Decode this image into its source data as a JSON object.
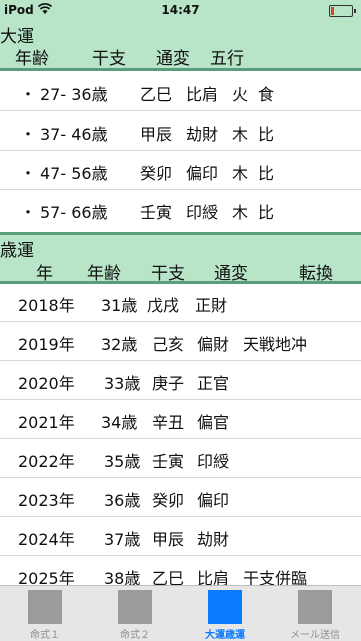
{
  "status": {
    "carrier": "iPod",
    "time": "14:47",
    "colors": {
      "bar": "#b8e4c8",
      "battery": "#e53b2b"
    }
  },
  "daiun": {
    "title": "大運",
    "columns": [
      "年齢",
      "干支",
      "通変",
      "五行"
    ],
    "rows": [
      {
        "bullet": "・",
        "age": "27- 36歳",
        "kanshi": "乙巳",
        "tsuhen": "比肩",
        "gogyo": "火",
        "rel": "食"
      },
      {
        "bullet": "・",
        "age": "37- 46歳",
        "kanshi": "甲辰",
        "tsuhen": "劫財",
        "gogyo": "木",
        "rel": "比"
      },
      {
        "bullet": "・",
        "age": "47- 56歳",
        "kanshi": "癸卯",
        "tsuhen": "偏印",
        "gogyo": "木",
        "rel": "比"
      },
      {
        "bullet": "・",
        "age": "57- 66歳",
        "kanshi": "壬寅",
        "tsuhen": "印綬",
        "gogyo": "木",
        "rel": "比"
      }
    ]
  },
  "saiun": {
    "title": "歳運",
    "columns": [
      "年",
      "年齢",
      "干支",
      "通変",
      "転換"
    ],
    "rows": [
      {
        "year": "2018年",
        "age": "31歳",
        "kanshi": "戊戌",
        "tsuhen": "正財",
        "tenkan": ""
      },
      {
        "year": "2019年",
        "age": "32歳",
        "kanshi": "己亥",
        "tsuhen": "偏財",
        "tenkan": "天戦地冲"
      },
      {
        "year": "2020年",
        "age": "33歳",
        "kanshi": "庚子",
        "tsuhen": "正官",
        "tenkan": ""
      },
      {
        "year": "2021年",
        "age": "34歳",
        "kanshi": "辛丑",
        "tsuhen": "偏官",
        "tenkan": ""
      },
      {
        "year": "2022年",
        "age": "35歳",
        "kanshi": "壬寅",
        "tsuhen": "印綬",
        "tenkan": ""
      },
      {
        "year": "2023年",
        "age": "36歳",
        "kanshi": "癸卯",
        "tsuhen": "偏印",
        "tenkan": ""
      },
      {
        "year": "2024年",
        "age": "37歳",
        "kanshi": "甲辰",
        "tsuhen": "劫財",
        "tenkan": ""
      },
      {
        "year": "2025年",
        "age": "38歳",
        "kanshi": "乙巳",
        "tsuhen": "比肩",
        "tenkan": "干支併臨"
      }
    ]
  },
  "tabs": [
    {
      "label": "命式１",
      "active": false
    },
    {
      "label": "命式２",
      "active": false
    },
    {
      "label": "大運歳運",
      "active": true
    },
    {
      "label": "メール送信",
      "active": false
    }
  ]
}
